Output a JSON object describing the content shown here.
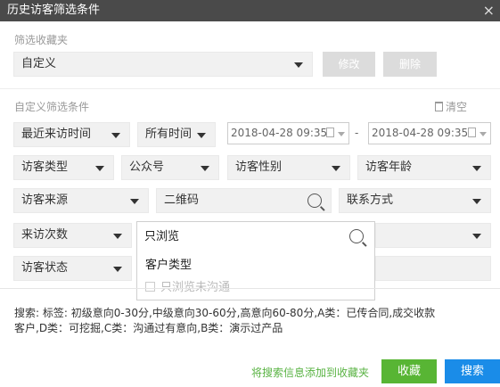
{
  "window": {
    "title": "历史访客筛选条件",
    "close_icon": "close-icon"
  },
  "favorites": {
    "label": "筛选收藏夹",
    "selected": "自定义",
    "edit_button": "修改",
    "delete_button": "删除"
  },
  "custom_filter": {
    "label": "自定义筛选条件",
    "clear_label": "清空",
    "clear_icon": "trash-icon"
  },
  "filters": {
    "recent_visit_time": "最近来访时间",
    "all_time": "所有时间",
    "start_date": "2018-04-28 09:35",
    "date_separator": "-",
    "end_date": "2018-04-28 09:35",
    "visitor_type": "访客类型",
    "public_account": "公众号",
    "visitor_gender": "访客性别",
    "visitor_age": "访客年龄",
    "visitor_source": "访客来源",
    "qr_code_placeholder": "二维码",
    "contact_method": "联系方式",
    "visit_count": "来访次数",
    "visitor_status": "访客状态"
  },
  "popup": {
    "input_value": "只浏览",
    "option_1": "客户类型",
    "option_2": "只浏览未沟通"
  },
  "summary": {
    "line_1": "搜索: 标签: 初级意向0-30分,中级意向30-60分,高意向60-80分,A类：已传合同,成交收款",
    "line_2": "客户,D类：可挖掘,C类：沟通过有意向,B类：演示过产品"
  },
  "footer": {
    "add_to_favorites": "将搜索信息添加到收藏夹",
    "collect_button": "收藏",
    "search_button": "搜索"
  },
  "colors": {
    "title_bar": "#4a4a4a",
    "green": "#58b534",
    "blue": "#1a8ce8"
  }
}
